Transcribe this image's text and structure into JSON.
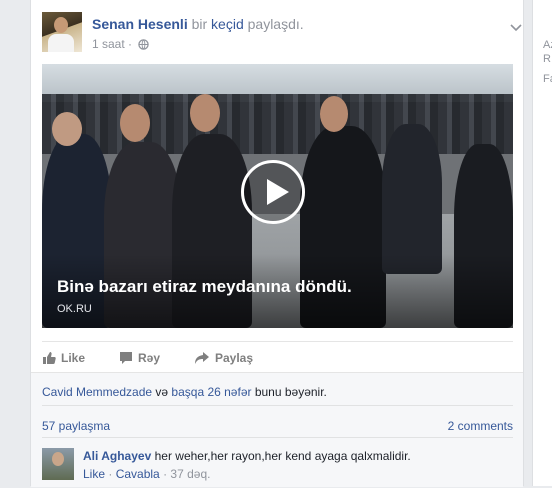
{
  "post": {
    "author": "Senan Hesenli",
    "action_text_1": "bir",
    "action_link": "keçid",
    "action_text_2": "paylaşdı.",
    "time": "1 saat",
    "privacy_icon": "globe-icon",
    "menu_icon": "chevron-down-icon"
  },
  "video": {
    "title": "Binə bazarı etiraz meydanına döndü.",
    "source": "OK.RU",
    "play_icon": "play-icon"
  },
  "actions": {
    "like": "Like",
    "comment": "Rəy",
    "share": "Paylaş"
  },
  "likes": {
    "name": "Cavid Memmedzade",
    "and_text": "və",
    "others": "başqa 26 nəfər",
    "suffix": "bunu bəyənir."
  },
  "stats": {
    "shares": "57 paylaşma",
    "comments": "2 comments"
  },
  "comment": {
    "author": "Ali Aghayev",
    "text": "her weher,her rayon,her kend ayaga qalxmalidir.",
    "like": "Like",
    "sep": "·",
    "reply": "Cavabla",
    "time": "37 dəq."
  },
  "rail": {
    "line1": "Az",
    "line2": "R",
    "line3": "Fa"
  }
}
